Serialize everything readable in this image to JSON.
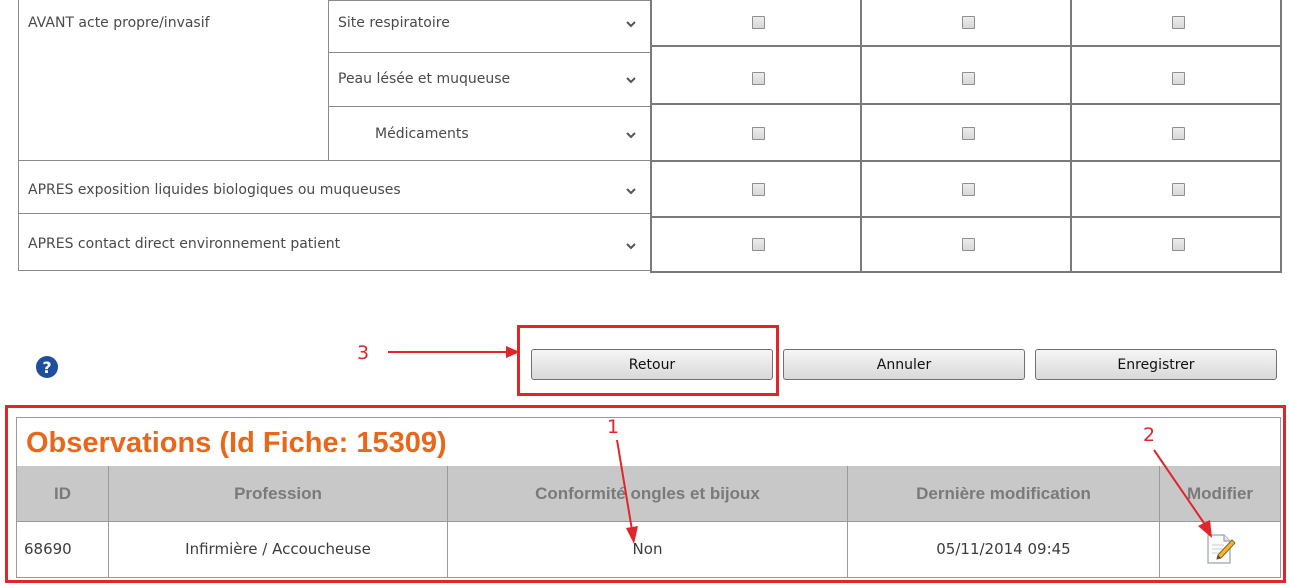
{
  "hygiene_table": {
    "rows": [
      {
        "group": "AVANT acte propre/invasif",
        "sub": "Site respiratoire"
      },
      {
        "group": "",
        "sub": "Peau lésée et muqueuse"
      },
      {
        "group": "",
        "sub": "Médicaments"
      },
      {
        "group": "APRES exposition liquides biologiques ou muqueuses",
        "sub": ""
      },
      {
        "group": "APRES contact direct environnement patient",
        "sub": ""
      }
    ]
  },
  "actions": {
    "help_icon_glyph": "?",
    "retour_label": "Retour",
    "annuler_label": "Annuler",
    "enregistrer_label": "Enregistrer"
  },
  "annotations": {
    "label_1": "1",
    "label_2": "2",
    "label_3": "3",
    "color": "#e0252b"
  },
  "observations": {
    "title": "Observations (Id Fiche: 15309)",
    "title_color": "#e8671a",
    "columns": [
      "ID",
      "Profession",
      "Conformité ongles et bijoux",
      "Dernière modification",
      "Modifier"
    ],
    "rows": [
      {
        "id": "68690",
        "profession": "Infirmière / Accoucheuse",
        "conformite": "Non",
        "derniere_modification": "05/11/2014 09:45",
        "modifier_icon": "edit-document-icon"
      }
    ]
  }
}
